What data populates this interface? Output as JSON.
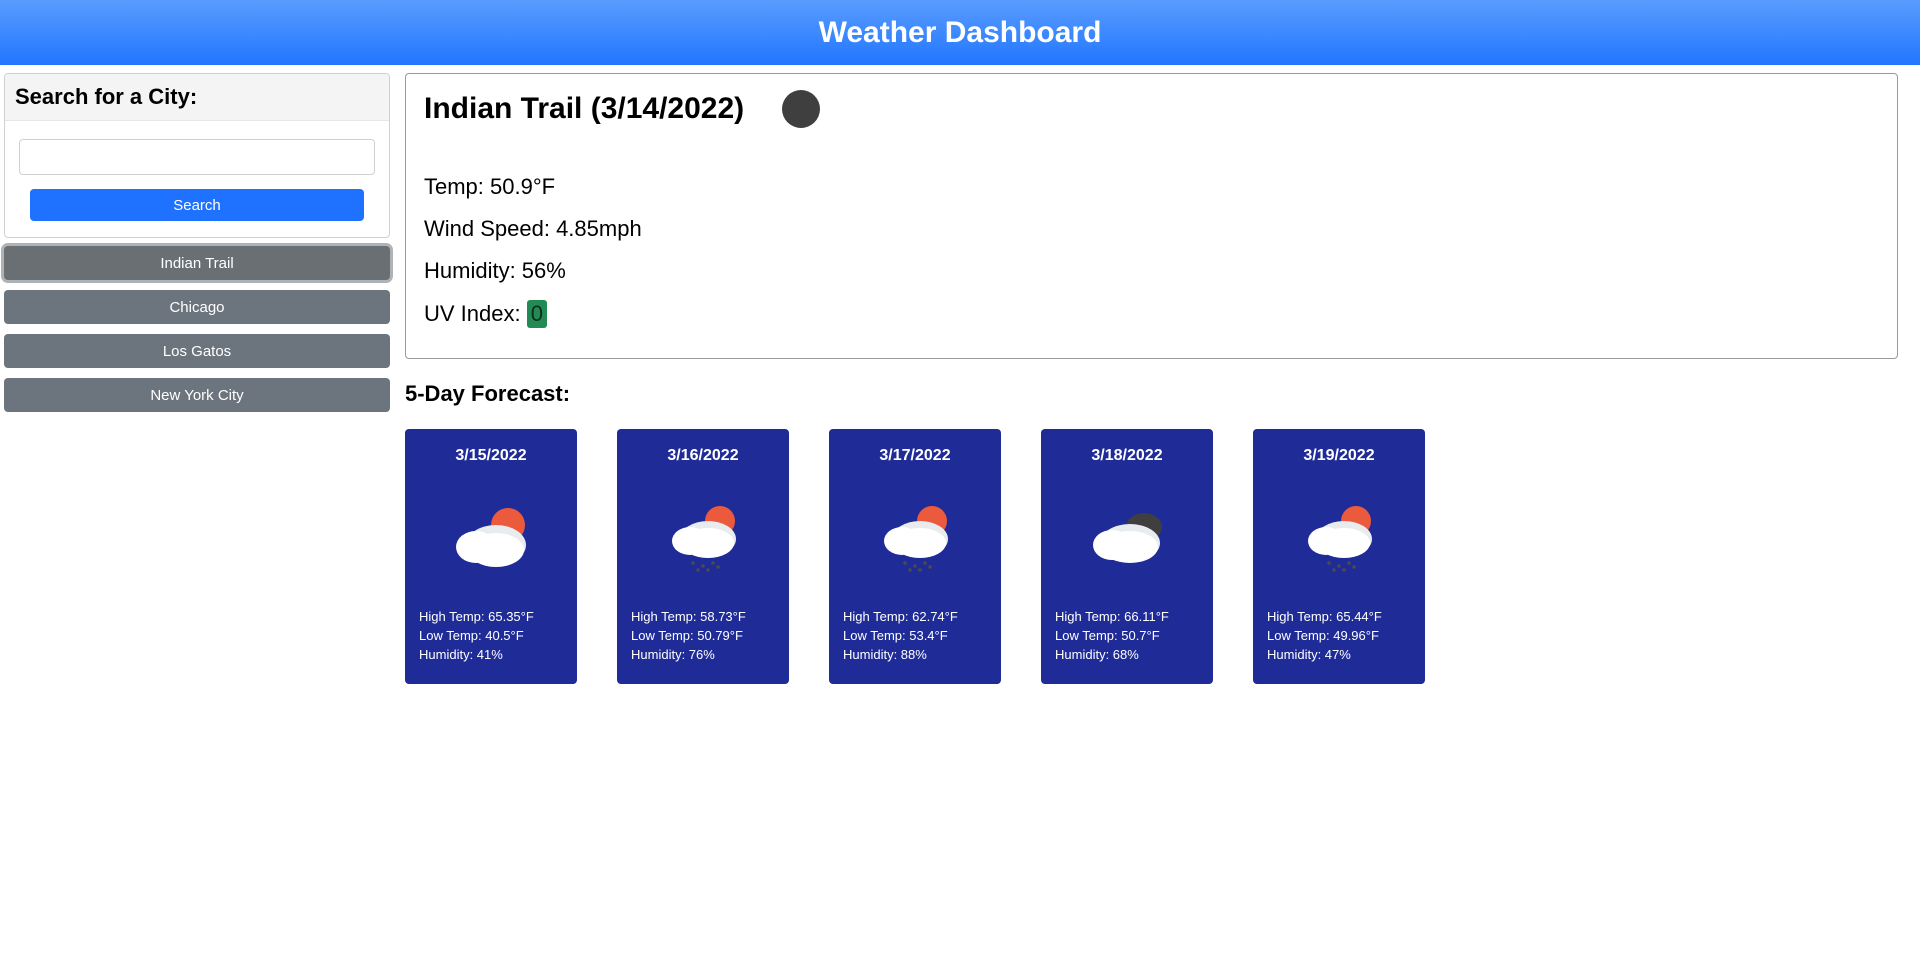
{
  "header": {
    "title": "Weather Dashboard"
  },
  "search": {
    "title": "Search for a City:",
    "placeholder": "",
    "value": "",
    "button": "Search"
  },
  "history": {
    "activeIndex": 0,
    "items": [
      "Indian Trail",
      "Chicago",
      "Los Gatos",
      "New York City"
    ]
  },
  "current": {
    "city": "Indian Trail",
    "date": "3/14/2022",
    "titleText": "Indian Trail   (3/14/2022)",
    "icon": "circle-dark",
    "tempLabel": "Temp: 50.9°F",
    "windLabel": "Wind Speed: 4.85mph",
    "humidityLabel": "Humidity: 56%",
    "uvPrefix": "UV Index: ",
    "uvValue": "0",
    "uvColor": "#228b53"
  },
  "forecast": {
    "title": "5-Day Forecast:",
    "days": [
      {
        "date": "3/15/2022",
        "icon": "cloud-sun",
        "high": "High Temp: 65.35°F",
        "low": "Low Temp: 40.5°F",
        "humidity": "Humidity: 41%"
      },
      {
        "date": "3/16/2022",
        "icon": "cloud-sun-rain",
        "high": "High Temp: 58.73°F",
        "low": "Low Temp: 50.79°F",
        "humidity": "Humidity: 76%"
      },
      {
        "date": "3/17/2022",
        "icon": "cloud-sun-rain",
        "high": "High Temp: 62.74°F",
        "low": "Low Temp: 53.4°F",
        "humidity": "Humidity: 88%"
      },
      {
        "date": "3/18/2022",
        "icon": "cloud-overcast",
        "high": "High Temp: 66.11°F",
        "low": "Low Temp: 50.7°F",
        "humidity": "Humidity: 68%"
      },
      {
        "date": "3/19/2022",
        "icon": "cloud-sun-rain",
        "high": "High Temp: 65.44°F",
        "low": "Low Temp: 49.96°F",
        "humidity": "Humidity: 47%"
      }
    ]
  }
}
